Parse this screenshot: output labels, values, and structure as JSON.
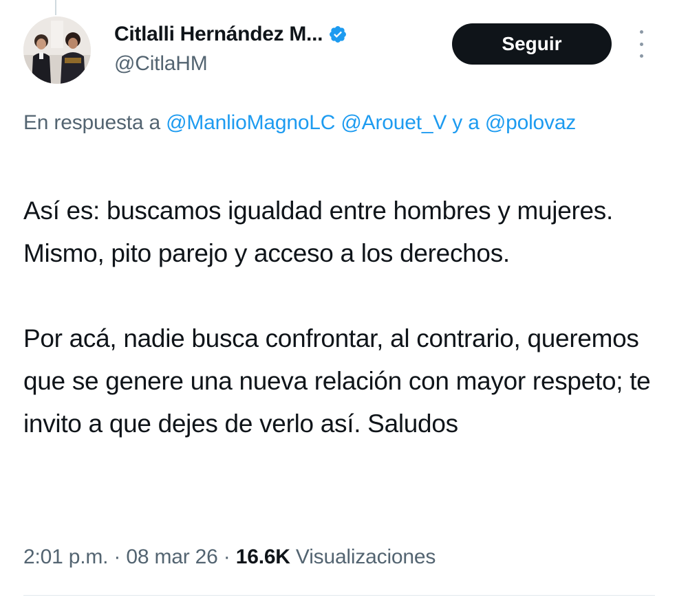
{
  "author": {
    "display_name": "Citlalli Hernández M...",
    "handle": "@CitlaHM",
    "verified": true
  },
  "follow_button": {
    "label": "Seguir"
  },
  "more_options": {
    "icon": "more-vertical-icon"
  },
  "reply_context": {
    "prefix": "En respuesta a",
    "mention_1": "@ManlioMagnoLC",
    "mention_2": "@Arouet_V",
    "joiner": "y a",
    "mention_3": "@polovaz"
  },
  "tweet": {
    "paragraph_1": "Así es: buscamos igualdad entre hombres y mujeres. Mismo, pito parejo y acceso a los derechos.",
    "paragraph_2": "Por acá, nadie busca confrontar, al contrario, queremos que se genere una nueva relación con mayor respeto; te invito a que dejes de verlo así. Saludos"
  },
  "meta": {
    "time": "2:01 p.m.",
    "separator": "·",
    "date": "08 mar 26",
    "views_count": "16.6K",
    "views_label": "Visualizaciones"
  },
  "colors": {
    "link": "#1d9bf0",
    "secondary_text": "#536471",
    "primary_text": "#0f1419",
    "button_bg": "#0f1419",
    "verified_badge": "#1d9bf0"
  }
}
